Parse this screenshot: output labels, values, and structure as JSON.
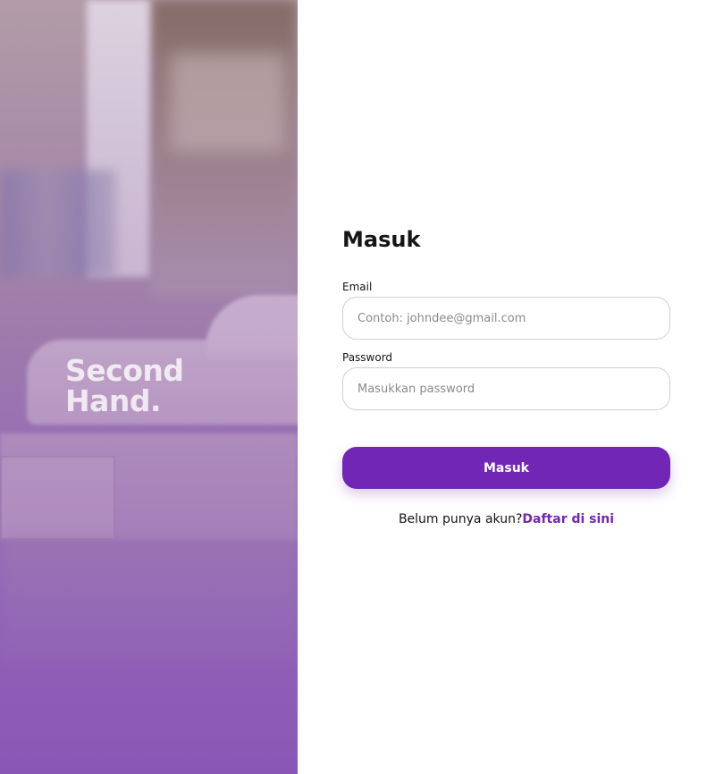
{
  "brand": {
    "line1": "Second",
    "line2": "Hand."
  },
  "login": {
    "title": "Masuk",
    "email": {
      "label": "Email",
      "placeholder": "Contoh: johndee@gmail.com",
      "value": ""
    },
    "password": {
      "label": "Password",
      "placeholder": "Masukkan password",
      "value": ""
    },
    "submit_label": "Masuk",
    "register_prompt": "Belum punya akun?",
    "register_link": "Daftar di sini"
  },
  "colors": {
    "accent": "#7126b5",
    "text": "#151515",
    "input_border": "#d0d0d0"
  }
}
